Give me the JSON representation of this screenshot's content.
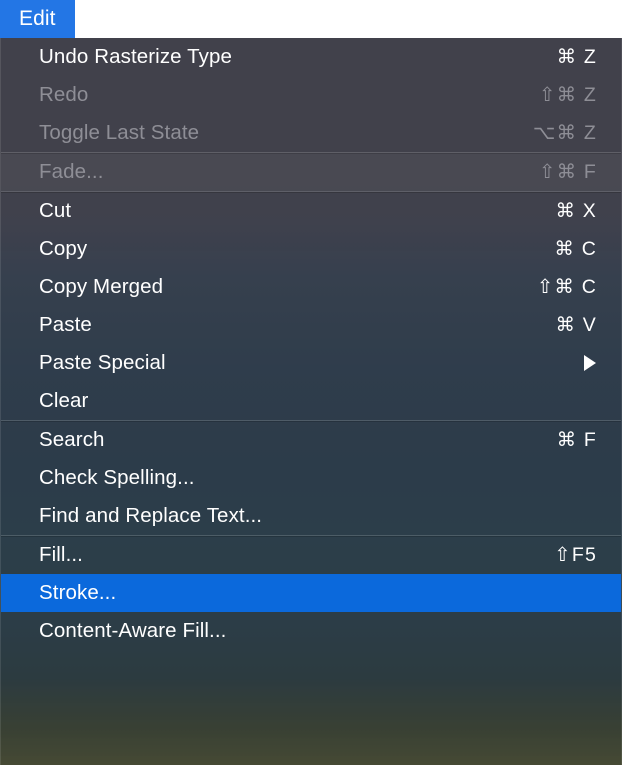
{
  "menubar": {
    "active_menu": "Edit"
  },
  "colors": {
    "menubar_highlight": "#2376e5",
    "selection": "#0b69dc",
    "enabled_text": "#ffffff",
    "disabled_text": "#8e8e96",
    "divider": "rgba(255,255,255,0.16)"
  },
  "menu": {
    "title": "Edit",
    "sections": [
      {
        "name": "undo-section",
        "style": "normal",
        "items": [
          {
            "label": "Undo Rasterize Type",
            "shortcut": "⌘ Z",
            "enabled": true,
            "selected": false,
            "submenu": false
          },
          {
            "label": "Redo",
            "shortcut": "⇧⌘ Z",
            "enabled": false,
            "selected": false,
            "submenu": false
          },
          {
            "label": "Toggle Last State",
            "shortcut": "⌥⌘ Z",
            "enabled": false,
            "selected": false,
            "submenu": false
          }
        ]
      },
      {
        "name": "fade-section",
        "style": "fade",
        "items": [
          {
            "label": "Fade...",
            "shortcut": "⇧⌘ F",
            "enabled": false,
            "selected": false,
            "submenu": false
          }
        ]
      },
      {
        "name": "clipboard-section",
        "style": "normal",
        "items": [
          {
            "label": "Cut",
            "shortcut": "⌘ X",
            "enabled": true,
            "selected": false,
            "submenu": false
          },
          {
            "label": "Copy",
            "shortcut": "⌘ C",
            "enabled": true,
            "selected": false,
            "submenu": false
          },
          {
            "label": "Copy Merged",
            "shortcut": "⇧⌘ C",
            "enabled": true,
            "selected": false,
            "submenu": false
          },
          {
            "label": "Paste",
            "shortcut": "⌘ V",
            "enabled": true,
            "selected": false,
            "submenu": false
          },
          {
            "label": "Paste Special",
            "shortcut": "",
            "enabled": true,
            "selected": false,
            "submenu": true
          },
          {
            "label": "Clear",
            "shortcut": "",
            "enabled": true,
            "selected": false,
            "submenu": false
          }
        ]
      },
      {
        "name": "search-section",
        "style": "normal",
        "items": [
          {
            "label": "Search",
            "shortcut": "⌘ F",
            "enabled": true,
            "selected": false,
            "submenu": false
          },
          {
            "label": "Check Spelling...",
            "shortcut": "",
            "enabled": true,
            "selected": false,
            "submenu": false
          },
          {
            "label": "Find and Replace Text...",
            "shortcut": "",
            "enabled": true,
            "selected": false,
            "submenu": false
          }
        ]
      },
      {
        "name": "fill-section",
        "style": "normal",
        "items": [
          {
            "label": "Fill...",
            "shortcut": "⇧F5",
            "enabled": true,
            "selected": false,
            "submenu": false
          },
          {
            "label": "Stroke...",
            "shortcut": "",
            "enabled": true,
            "selected": true,
            "submenu": false
          },
          {
            "label": "Content-Aware Fill...",
            "shortcut": "",
            "enabled": true,
            "selected": false,
            "submenu": false
          }
        ]
      }
    ]
  }
}
